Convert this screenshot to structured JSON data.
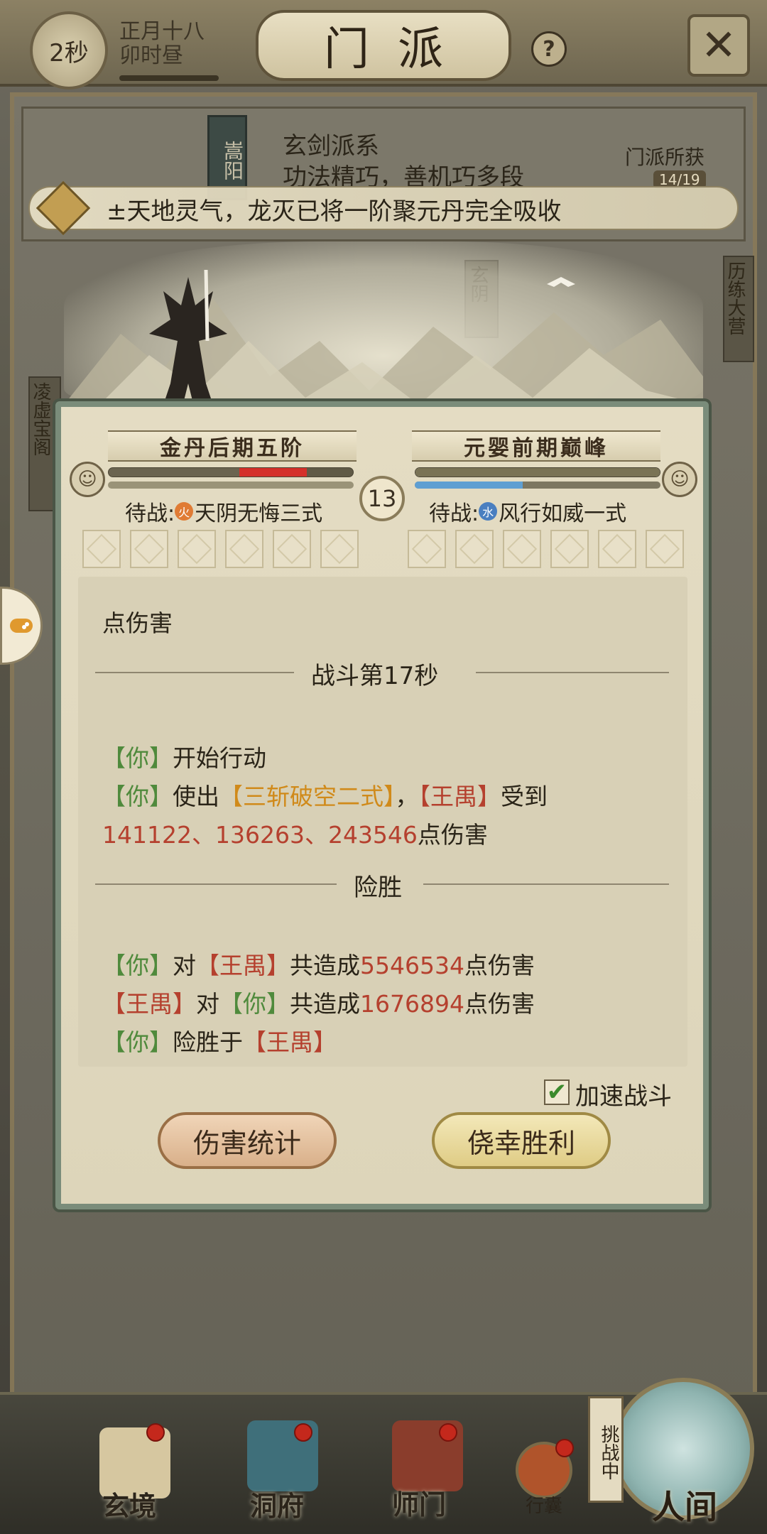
{
  "header": {
    "timer": "2秒",
    "lunar_date": "正月十八",
    "time_of_day": "卯时昼",
    "title": "门派",
    "help_icon": "question-icon",
    "close_icon": "close-icon"
  },
  "sect": {
    "vertical_name": "嵩阳",
    "series": "玄剑派系",
    "description": "功法精巧，善机巧多段",
    "reward_label": "门派所获",
    "reward_count": "14/19"
  },
  "notice": {
    "icon": "bell-icon",
    "text": "±天地灵气，龙灭已将一阶聚元丹完全吸收"
  },
  "battle": {
    "round": "13",
    "left": {
      "rank": "金丹后期五阶",
      "hp_fraction": 0.81,
      "mp_fraction": 1.0,
      "hp_color": "#d4302a",
      "waiting_label": "待战:",
      "element": "火",
      "element_color": "#e07b34",
      "skill": "天阴无悔三式"
    },
    "right": {
      "rank": "元婴前期巅峰",
      "hp_fraction": 1.0,
      "mp_fraction": 0.44,
      "mp_color": "#5f9fd2",
      "waiting_label": "待战:",
      "element": "水",
      "element_color": "#4a7fc0",
      "skill": "风行如威一式"
    },
    "log": {
      "partial_line": "点伤害",
      "round_header": "战斗第17秒",
      "line1_actor": "【你】",
      "line1_text": "开始行动",
      "line2_actor": "【你】",
      "line2_use": "使出",
      "line2_skill": "【三斩破空二式】",
      "line2_comma": "，",
      "line2_target": "【王禺】",
      "line2_receive": "受到",
      "line3_numbers": "141122、136263、243546",
      "line3_suffix": "点伤害",
      "result_header": "险胜",
      "sum1_actor": "【你】",
      "sum1_vs": "对",
      "sum1_target": "【王禺】",
      "sum1_text": "共造成",
      "sum1_value": "5546534",
      "sum1_suffix": "点伤害",
      "sum2_actor": "【王禺】",
      "sum2_vs": "对",
      "sum2_target": "【你】",
      "sum2_text": "共造成",
      "sum2_value": "1676894",
      "sum2_suffix": "点伤害",
      "sum3_actor": "【你】",
      "sum3_text": "险胜于",
      "sum3_target": "【王禺】"
    },
    "speed_label": "加速战斗",
    "speed_checked": true,
    "btn_stats": "伤害统计",
    "btn_victory": "侥幸胜利"
  },
  "side_labels": {
    "left": "凌虚宝阁",
    "right_top": "玄阴",
    "right_edge": "历练大营"
  },
  "bottom_nav": [
    {
      "label": "玄境",
      "icon": "scroll-icon"
    },
    {
      "label": "洞府",
      "icon": "pavilion-icon"
    },
    {
      "label": "师门",
      "icon": "banner-icon"
    },
    {
      "label": "行囊",
      "icon": "bag-icon"
    },
    {
      "label": "人间",
      "icon": "world-icon"
    }
  ],
  "challenge_tag": "挑战中"
}
